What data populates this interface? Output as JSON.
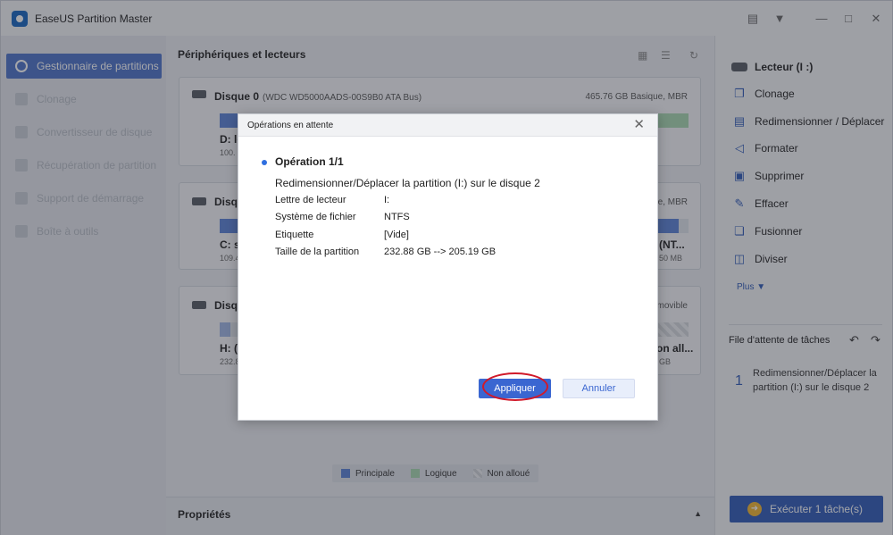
{
  "app": {
    "title": "EaseUS Partition Master"
  },
  "sidebar": {
    "items": [
      {
        "label": "Gestionnaire de partitions"
      },
      {
        "label": "Clonage"
      },
      {
        "label": "Convertisseur de disque"
      },
      {
        "label": "Récupération de partition"
      },
      {
        "label": "Support de démarrage"
      },
      {
        "label": "Boîte à outils"
      }
    ]
  },
  "main": {
    "header": "Périphériques et lecteurs",
    "disks": [
      {
        "name": "Disque 0",
        "model": "(WDC WD5000AADS-00S9B0 ATA Bus)",
        "info": "465.76 GB Basique, MBR",
        "part_left_name": "D: lo",
        "part_left_size": "100.",
        "part_right_name": "",
        "part_right_size": ""
      },
      {
        "name": "Disqu",
        "model": "",
        "info": "GB Basique, MBR",
        "part_left_name": "C: sy",
        "part_left_size": "109.4",
        "part_right_name": "(NT...",
        "part_right_size": "50 MB"
      },
      {
        "name": "Disqu",
        "model": "",
        "info": "movible",
        "part_left_name": "H: (I",
        "part_left_size": "232.8",
        "part_right_name": "on all...",
        "part_right_size": "GB"
      }
    ],
    "legend": {
      "primary": "Principale",
      "logical": "Logique",
      "unallocated": "Non alloué"
    },
    "properties": "Propriétés"
  },
  "right_panel": {
    "drive_title": "Lecteur (I :)",
    "actions": [
      {
        "label": "Clonage",
        "icon": "clone-icon"
      },
      {
        "label": "Redimensionner / Déplacer",
        "icon": "resize-icon"
      },
      {
        "label": "Formater",
        "icon": "format-icon"
      },
      {
        "label": "Supprimer",
        "icon": "trash-icon"
      },
      {
        "label": "Effacer",
        "icon": "eraser-icon"
      },
      {
        "label": "Fusionner",
        "icon": "merge-icon"
      },
      {
        "label": "Diviser",
        "icon": "split-icon"
      }
    ],
    "more": "Plus",
    "queue_title": "File d'attente de tâches",
    "queue_items": [
      {
        "num": "1",
        "text": "Redimensionner/Déplacer la partition (I:) sur le disque 2"
      }
    ],
    "execute_label": "Exécuter 1 tâche(s)"
  },
  "modal": {
    "title": "Opérations en attente",
    "operation_title": "Opération 1/1",
    "operation_desc": "Redimensionner/Déplacer la partition (I:) sur le disque 2",
    "fields": [
      {
        "label": "Lettre de lecteur",
        "value": "I:"
      },
      {
        "label": "Système de fichier",
        "value": "NTFS"
      },
      {
        "label": "Etiquette",
        "value": "[Vide]"
      },
      {
        "label": "Taille de la partition",
        "value": "232.88 GB --> 205.19 GB"
      }
    ],
    "apply_label": "Appliquer",
    "cancel_label": "Annuler"
  },
  "colors": {
    "accent": "#3a66d1",
    "primary_partition": "#5b82d6",
    "logical_partition": "#a7d8b0",
    "highlight_ring": "#d11a2a"
  }
}
